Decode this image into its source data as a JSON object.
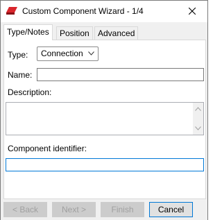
{
  "window": {
    "title": "Custom Component Wizard - 1/4",
    "accent_color": "#d9262c"
  },
  "tabs": [
    {
      "label": "Type/Notes",
      "active": true
    },
    {
      "label": "Position",
      "active": false
    },
    {
      "label": "Advanced",
      "active": false
    }
  ],
  "form": {
    "type_label": "Type:",
    "type_value": "Connection",
    "name_label": "Name:",
    "name_value": "",
    "description_label": "Description:",
    "description_value": "",
    "identifier_label": "Component identifier:",
    "identifier_value": ""
  },
  "buttons": {
    "back": "< Back",
    "next": "Next >",
    "finish": "Finish",
    "cancel": "Cancel"
  },
  "icons": {
    "app": "custom-component-icon",
    "close": "close-icon",
    "dropdown": "chevron-down-icon",
    "scroll_up": "scroll-up-icon",
    "scroll_down": "scroll-down-icon"
  }
}
